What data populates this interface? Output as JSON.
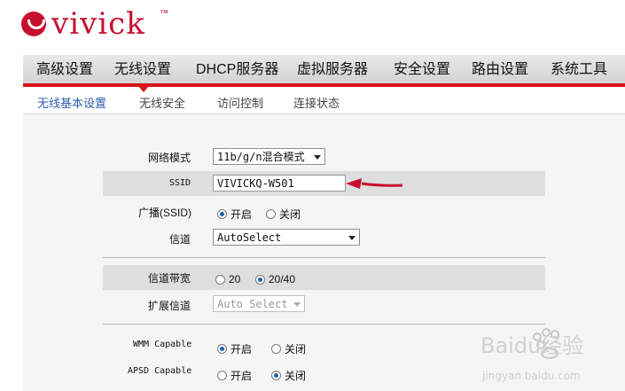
{
  "brand": {
    "name": "vivick",
    "tm": "™"
  },
  "nav": {
    "items": [
      "高级设置",
      "无线设置",
      "DHCP服务器",
      "虚拟服务器",
      "安全设置",
      "路由设置",
      "系统工具"
    ]
  },
  "subnav": {
    "items": [
      "无线基本设置",
      "无线安全",
      "访问控制",
      "连接状态"
    ],
    "active": "无线基本设置"
  },
  "form": {
    "network_mode": {
      "label": "网络模式",
      "value": "11b/g/n混合模式"
    },
    "ssid": {
      "label": "SSID",
      "value": "VIVICKQ-W501"
    },
    "broadcast": {
      "label": "广播(SSID)",
      "on": "开启",
      "off": "关闭",
      "selected": "on"
    },
    "channel": {
      "label": "信道",
      "value": "AutoSelect"
    },
    "bandwidth": {
      "label": "信道带宽",
      "opt1": "20",
      "opt2": "20/40",
      "selected": "20/40"
    },
    "ext_channel": {
      "label": "扩展信道",
      "value": "Auto Select"
    },
    "wmm": {
      "label": "WMM Capable",
      "on": "开启",
      "off": "关闭",
      "selected": "on"
    },
    "apsd": {
      "label": "APSD Capable",
      "on": "开启",
      "off": "关闭",
      "selected": "off"
    }
  },
  "watermark": {
    "text": "Baidu经验",
    "url": "jingyan.baidu.com"
  },
  "colors": {
    "brand_red": "#c8102e",
    "nav_red": "#d7141a",
    "active_link": "#2b5fb3"
  }
}
